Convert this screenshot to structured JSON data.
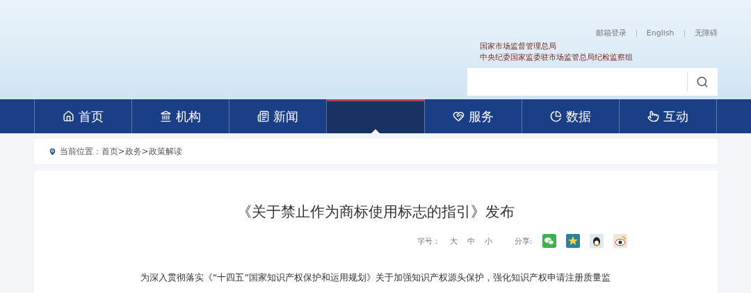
{
  "top_links": [
    "邮箱登录",
    "English",
    "无障碍"
  ],
  "org_names": [
    "国家市场监督管理总局",
    "中央纪委国家监委驻市场监管总局纪检监察组"
  ],
  "nav": [
    {
      "kind": "home",
      "label": "首页",
      "selected": false
    },
    {
      "kind": "bank",
      "label": "机构",
      "selected": false
    },
    {
      "kind": "news",
      "label": "新闻",
      "selected": false
    },
    {
      "kind": "blank",
      "selected": true
    },
    {
      "kind": "heart",
      "label": "服务",
      "selected": false
    },
    {
      "kind": "pie",
      "label": "数据",
      "selected": false
    },
    {
      "kind": "hand",
      "label": "互动",
      "selected": false
    }
  ],
  "breadcrumb": "当前位置：首页>政务>政策解读",
  "article": {
    "title": "《关于禁止作为商标使用标志的指引》发布",
    "font_size_label": "字号：",
    "font_sizes": [
      "大",
      "中",
      "小"
    ],
    "share_label": "分享:",
    "share": [
      {
        "kind": "wechat"
      },
      {
        "kind": "star"
      },
      {
        "kind": "qq"
      },
      {
        "kind": "weibo"
      }
    ],
    "body": "为深入贯彻落实《“十四五”国家知识产权保护和运用规划》关于加强知识产权源头保护，强化知识产权申请注册质量监"
  }
}
